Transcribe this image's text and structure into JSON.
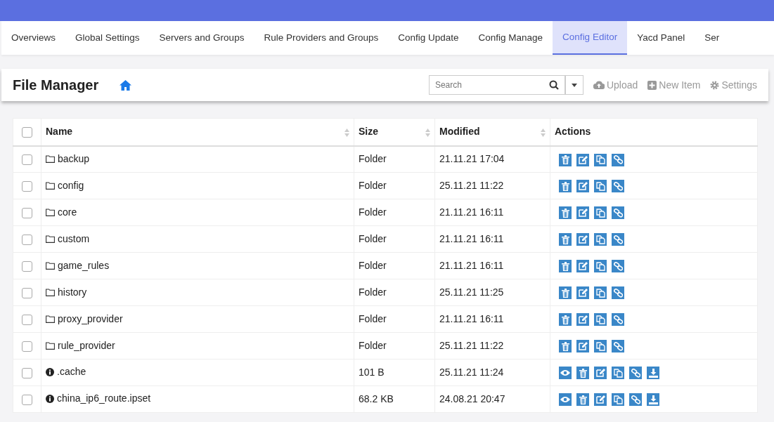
{
  "tabs": [
    {
      "label": "Overviews",
      "selected": false
    },
    {
      "label": "Global Settings",
      "selected": false
    },
    {
      "label": "Servers and Groups",
      "selected": false
    },
    {
      "label": "Rule Providers and Groups",
      "selected": false
    },
    {
      "label": "Config Update",
      "selected": false
    },
    {
      "label": "Config Manage",
      "selected": false
    },
    {
      "label": "Config Editor",
      "selected": true
    },
    {
      "label": "Yacd Panel",
      "selected": false
    },
    {
      "label": "Ser",
      "selected": false
    }
  ],
  "file_manager": {
    "title": "File Manager",
    "search": {
      "placeholder": "Search"
    },
    "toolbar": [
      "Upload",
      "New Item",
      "Settings"
    ]
  },
  "table": {
    "select_all": {
      "checked": false
    },
    "columns": [
      "Name",
      "Size",
      "Modified",
      "Actions"
    ],
    "rows": [
      {
        "kind": "folder",
        "name": "backup",
        "size": "Folder",
        "modified": "21.11.21 17:04",
        "checked": false,
        "actions": [
          {
            "kind": "delete"
          },
          {
            "kind": "edit"
          },
          {
            "kind": "copy"
          },
          {
            "kind": "link"
          }
        ]
      },
      {
        "kind": "folder",
        "name": "config",
        "size": "Folder",
        "modified": "25.11.21 11:22",
        "checked": false,
        "actions": [
          {
            "kind": "delete"
          },
          {
            "kind": "edit"
          },
          {
            "kind": "copy"
          },
          {
            "kind": "link"
          }
        ]
      },
      {
        "kind": "folder",
        "name": "core",
        "size": "Folder",
        "modified": "21.11.21 16:11",
        "checked": false,
        "actions": [
          {
            "kind": "delete"
          },
          {
            "kind": "edit"
          },
          {
            "kind": "copy"
          },
          {
            "kind": "link"
          }
        ]
      },
      {
        "kind": "folder",
        "name": "custom",
        "size": "Folder",
        "modified": "21.11.21 16:11",
        "checked": false,
        "actions": [
          {
            "kind": "delete"
          },
          {
            "kind": "edit"
          },
          {
            "kind": "copy"
          },
          {
            "kind": "link"
          }
        ]
      },
      {
        "kind": "folder",
        "name": "game_rules",
        "size": "Folder",
        "modified": "21.11.21 16:11",
        "checked": false,
        "actions": [
          {
            "kind": "delete"
          },
          {
            "kind": "edit"
          },
          {
            "kind": "copy"
          },
          {
            "kind": "link"
          }
        ]
      },
      {
        "kind": "folder",
        "name": "history",
        "size": "Folder",
        "modified": "25.11.21 11:25",
        "checked": false,
        "actions": [
          {
            "kind": "delete"
          },
          {
            "kind": "edit"
          },
          {
            "kind": "copy"
          },
          {
            "kind": "link"
          }
        ]
      },
      {
        "kind": "folder",
        "name": "proxy_provider",
        "size": "Folder",
        "modified": "21.11.21 16:11",
        "checked": false,
        "actions": [
          {
            "kind": "delete"
          },
          {
            "kind": "edit"
          },
          {
            "kind": "copy"
          },
          {
            "kind": "link"
          }
        ]
      },
      {
        "kind": "folder",
        "name": "rule_provider",
        "size": "Folder",
        "modified": "25.11.21 11:22",
        "checked": false,
        "actions": [
          {
            "kind": "delete"
          },
          {
            "kind": "edit"
          },
          {
            "kind": "copy"
          },
          {
            "kind": "link"
          }
        ]
      },
      {
        "kind": "file",
        "name": ".cache",
        "size": "101 B",
        "modified": "25.11.21 11:24",
        "checked": false,
        "actions": [
          {
            "kind": "view"
          },
          {
            "kind": "delete"
          },
          {
            "kind": "edit"
          },
          {
            "kind": "copy"
          },
          {
            "kind": "link"
          },
          {
            "kind": "download"
          }
        ]
      },
      {
        "kind": "file",
        "name": "china_ip6_route.ipset",
        "size": "68.2 KB",
        "modified": "24.08.21 20:47",
        "checked": false,
        "actions": [
          {
            "kind": "view"
          },
          {
            "kind": "delete"
          },
          {
            "kind": "edit"
          },
          {
            "kind": "copy"
          },
          {
            "kind": "link"
          },
          {
            "kind": "download"
          }
        ]
      }
    ]
  }
}
